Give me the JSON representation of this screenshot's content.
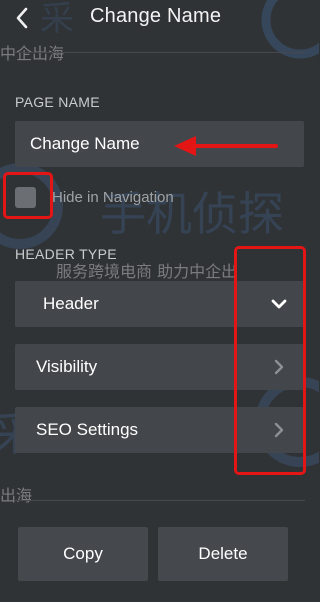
{
  "header": {
    "title": "Change Name",
    "back_icon": "chevron-left-icon"
  },
  "watermark": {
    "line_top": "中企出海",
    "line_middle": "服务跨境电商 助力中企出",
    "line_bottom": "出海"
  },
  "page_name": {
    "label": "PAGE NAME",
    "value": "Change Name"
  },
  "hide_in_navigation": {
    "label": "Hide in Navigation",
    "checked": false
  },
  "header_type": {
    "label": "HEADER TYPE",
    "selected": "Header",
    "icon": "chevron-down-icon"
  },
  "rows": [
    {
      "label": "Visibility",
      "icon": "chevron-right-icon"
    },
    {
      "label": "SEO Settings",
      "icon": "chevron-right-icon"
    }
  ],
  "actions": {
    "copy_label": "Copy",
    "delete_label": "Delete"
  },
  "colors": {
    "panel_bg": "#303336",
    "field_bg": "#43474b",
    "annotation": "#e41515"
  }
}
